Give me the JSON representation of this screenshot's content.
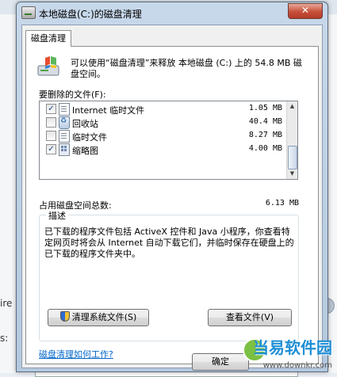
{
  "background": {
    "fragment_left": "ire",
    "fragment_left2": "s:"
  },
  "window": {
    "title": "本地磁盘(C:)的磁盘清理",
    "close_glyph": "✕",
    "tab_label": "磁盘清理",
    "intro_text": "可以使用“磁盘清理”来释放 本地磁盘 (C:) 上的 54.8 MB 磁盘空间。",
    "files_label": "要删除的文件(F):",
    "files": [
      {
        "name": "Internet 临时文件",
        "size": "1.05 MB",
        "checked": true,
        "icon": "internet-files-icon"
      },
      {
        "name": "回收站",
        "size": "40.4 MB",
        "checked": false,
        "icon": "recycle-bin-icon"
      },
      {
        "name": "临时文件",
        "size": "8.27 MB",
        "checked": false,
        "icon": "temp-files-icon"
      },
      {
        "name": "缩略图",
        "size": "4.00 MB",
        "checked": true,
        "icon": "thumbnails-icon"
      }
    ],
    "total_label": "占用磁盘空间总数:",
    "total_value": "6.13 MB",
    "description_title": "描述",
    "description_text": "已下载的程序文件包括 ActiveX 控件和 Java 小程序，你查看特定网页时将会从 Internet 自动下载它们，并临时保存在硬盘上的已下载的程序文件夹中。",
    "clean_system_button": "清理系统文件(S)",
    "view_files_button": "查看文件(V)",
    "help_link": "磁盘清理如何工作?",
    "ok_button": "确定"
  },
  "watermark": {
    "brand": "当易软件园",
    "url": "www.downkr.com"
  }
}
